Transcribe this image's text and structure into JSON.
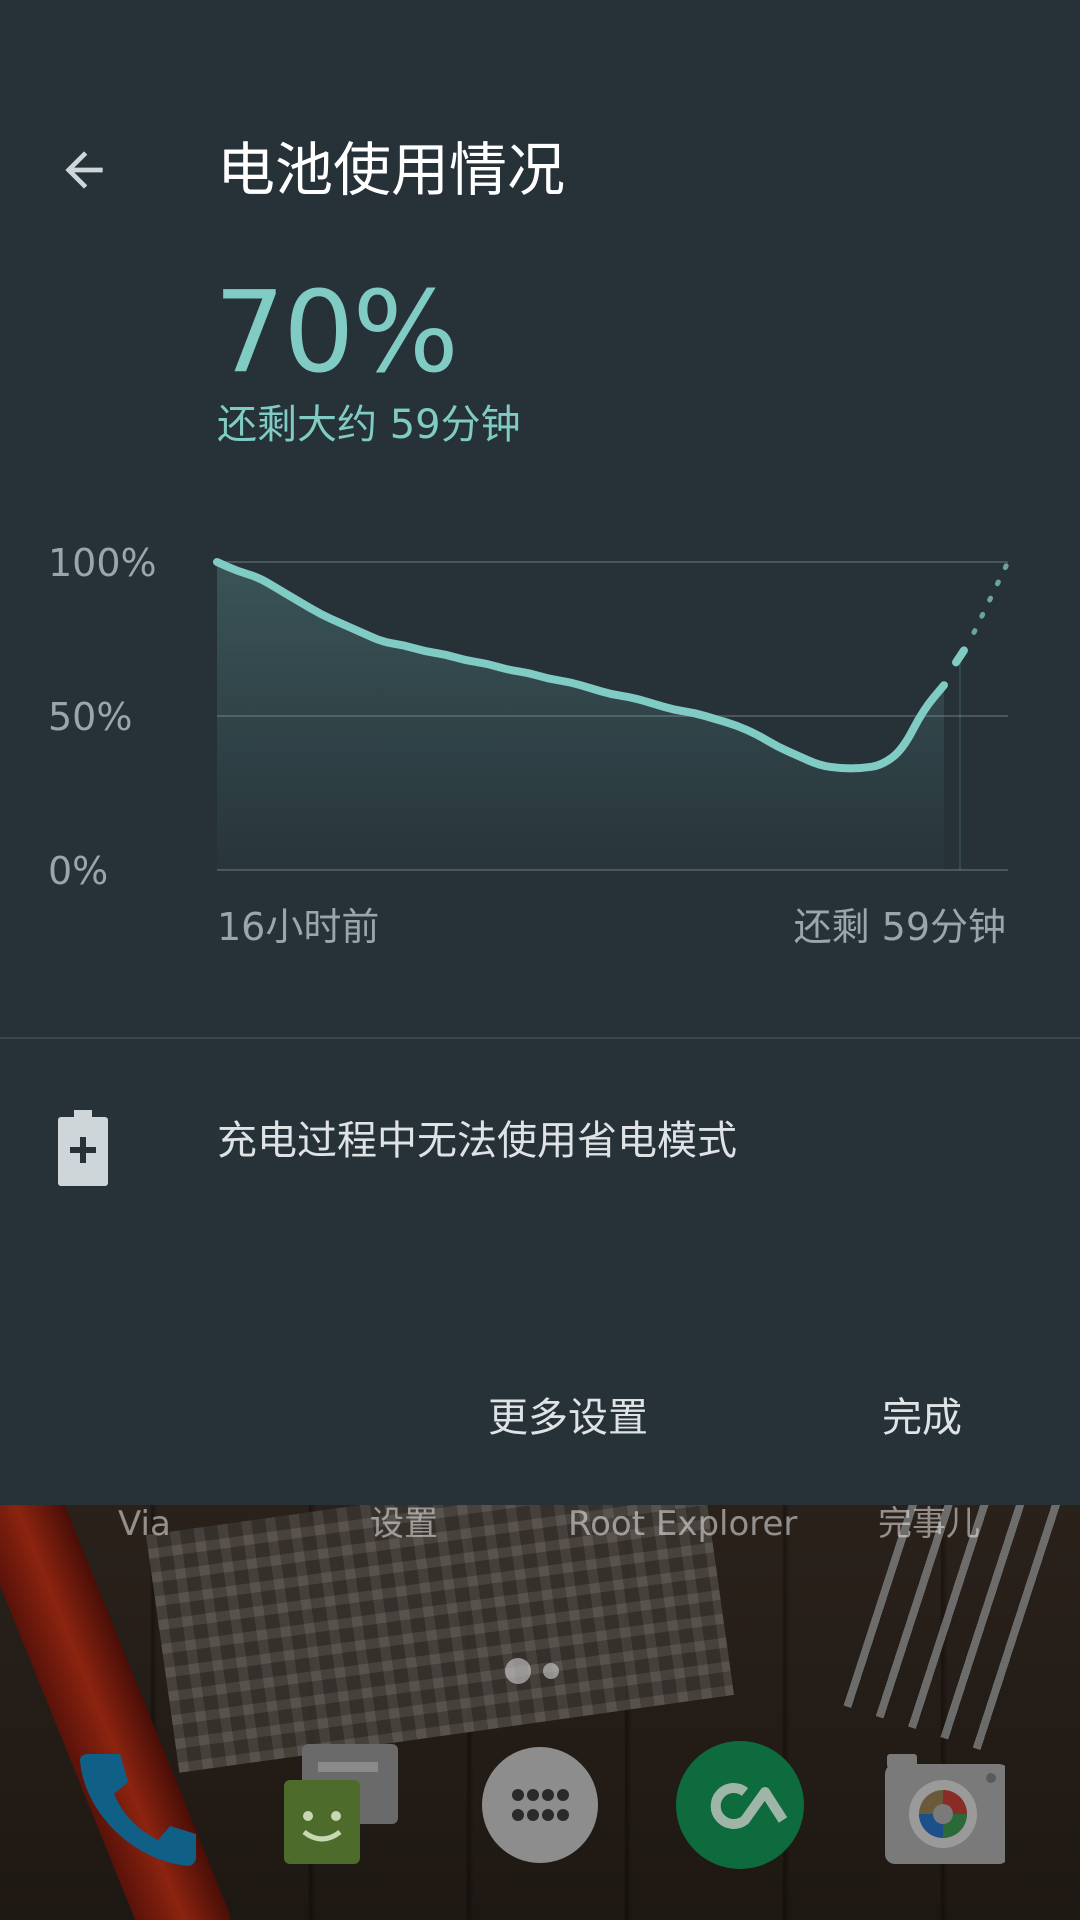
{
  "header": {
    "title": "电池使用情况"
  },
  "battery": {
    "percent": "70%",
    "remaining": "还剩大约 59分钟"
  },
  "chart_data": {
    "type": "line",
    "y_ticks": [
      "100%",
      "50%",
      "0%"
    ],
    "ylim": [
      0,
      100
    ],
    "x_start_label": "16小时前",
    "x_end_label": "还剩 59分钟",
    "grid": true,
    "series": [
      {
        "values": [
          100,
          97,
          95,
          91,
          87,
          83,
          80,
          77,
          74,
          73,
          71,
          70,
          68,
          67,
          65,
          64,
          62,
          61,
          59,
          57,
          56,
          54,
          52,
          51,
          49,
          47,
          44,
          40,
          37,
          34,
          33,
          33,
          34,
          39,
          52,
          60
        ]
      }
    ],
    "projection": {
      "from": 70,
      "to": 100
    },
    "colors": {
      "line": "#80cbc4",
      "grid": "#4a565c"
    }
  },
  "saver": {
    "icon": "battery-charging-icon",
    "text": "充电过程中无法使用省电模式"
  },
  "actions": {
    "more_settings": "更多设置",
    "done": "完成"
  },
  "launcher": {
    "app_labels": [
      "Via",
      "设置",
      "Root Explorer",
      "完事儿"
    ],
    "dock": [
      "phone-icon",
      "messaging-icon",
      "app-drawer-icon",
      "app-icon",
      "camera-icon"
    ]
  },
  "colors": {
    "panel_bg": "#263238",
    "accent": "#80cbc4"
  }
}
